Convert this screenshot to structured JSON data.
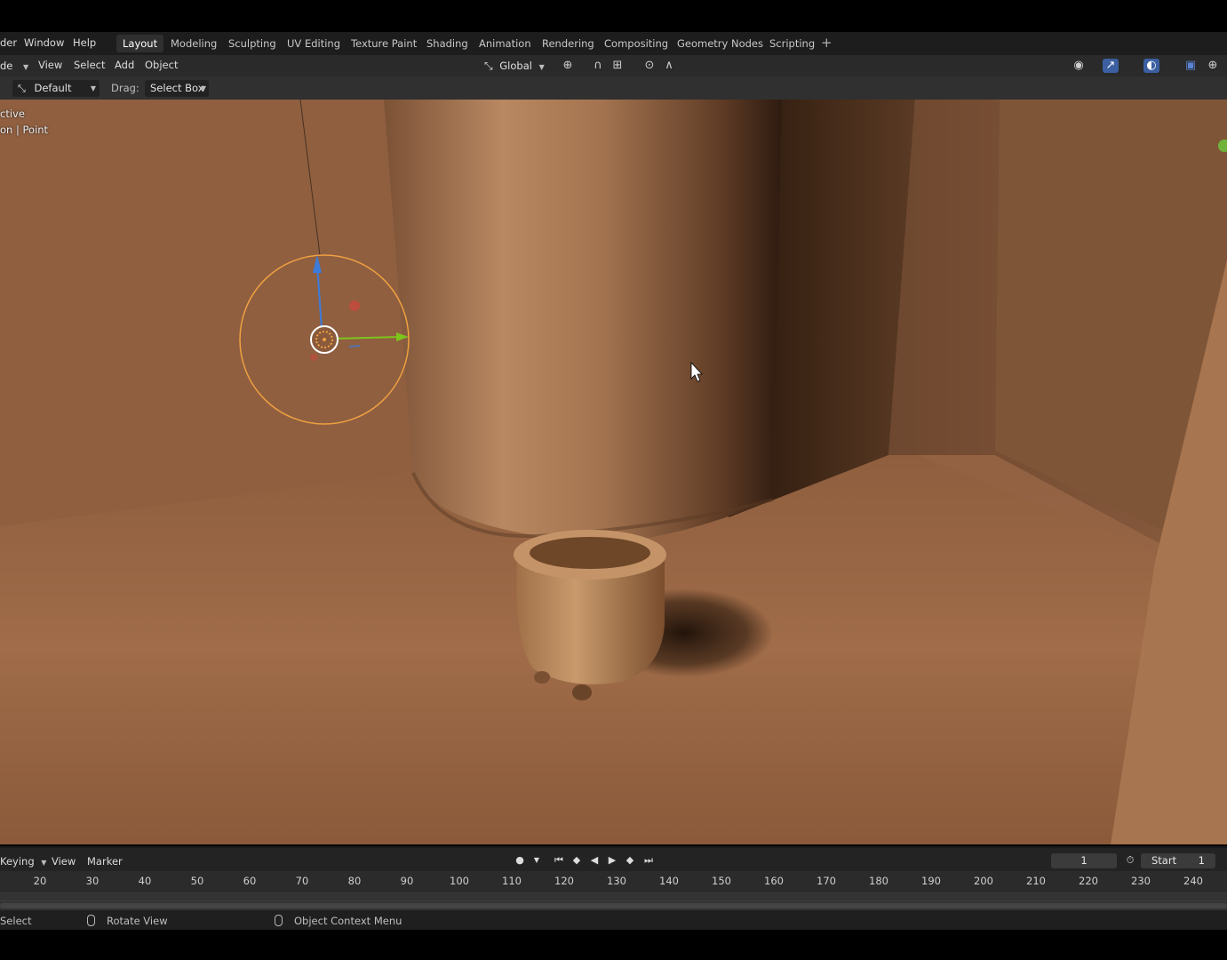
{
  "topbar": {
    "menus": [
      "der",
      "Window",
      "Help"
    ],
    "workspaces": [
      "Layout",
      "Modeling",
      "Sculpting",
      "UV Editing",
      "Texture Paint",
      "Shading",
      "Animation",
      "Rendering",
      "Compositing",
      "Geometry Nodes",
      "Scripting"
    ],
    "active_workspace": "Layout",
    "add_tab": "+"
  },
  "viewport_header": {
    "mode": "de",
    "menus": [
      "View",
      "Select",
      "Add",
      "Object"
    ],
    "transform_orientation": "Global"
  },
  "tool_settings": {
    "orientation": "Default",
    "drag_label": "Drag:",
    "drag_value": "Select Box"
  },
  "viewport": {
    "overlay_line1": "ctive",
    "overlay_line2": "on | Point"
  },
  "timeline": {
    "menus": [
      "Keying",
      "View",
      "Marker"
    ],
    "current_frame": "1",
    "start_label": "Start",
    "start_value": "1",
    "ruler_ticks": [
      "20",
      "30",
      "40",
      "50",
      "60",
      "70",
      "80",
      "90",
      "100",
      "110",
      "120",
      "130",
      "140",
      "150",
      "160",
      "170",
      "180",
      "190",
      "200",
      "210",
      "220",
      "230",
      "240"
    ]
  },
  "statusbar": {
    "select": "Select",
    "rotate": "Rotate View",
    "context": "Object Context Menu"
  },
  "colors": {
    "accent_blue": "#3b5fa0",
    "light_orange": "#f0a040",
    "gizmo_x": "#e0463f",
    "gizmo_y": "#7dc41d",
    "gizmo_z": "#3c7cdd"
  }
}
